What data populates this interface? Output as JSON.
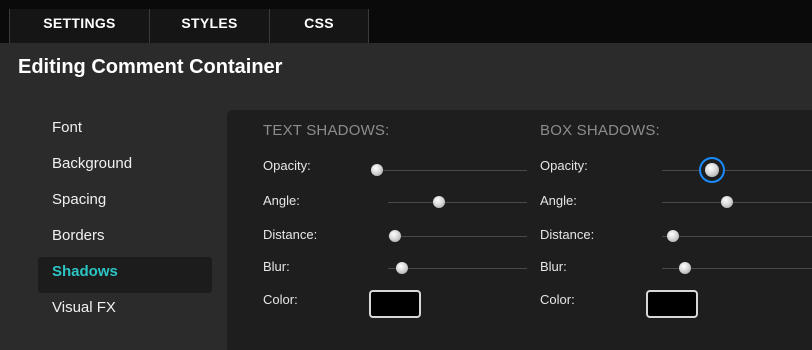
{
  "tabs": [
    {
      "label": "SETTINGS"
    },
    {
      "label": "STYLES"
    },
    {
      "label": "CSS"
    }
  ],
  "title": "Editing Comment Container",
  "sidebar": {
    "items": [
      {
        "label": "Font"
      },
      {
        "label": "Background"
      },
      {
        "label": "Spacing"
      },
      {
        "label": "Borders"
      },
      {
        "label": "Shadows",
        "active": true
      },
      {
        "label": "Visual FX"
      }
    ]
  },
  "text_shadows": {
    "heading": "TEXT SHADOWS:",
    "opacity": {
      "label": "Opacity:",
      "value_fraction": 0.0
    },
    "angle": {
      "label": "Angle:",
      "value_fraction": 0.37
    },
    "distance": {
      "label": "Distance:",
      "value_fraction": 0.05
    },
    "blur": {
      "label": "Blur:",
      "value_fraction": 0.1
    },
    "color": {
      "label": "Color:",
      "value": "#000000"
    }
  },
  "box_shadows": {
    "heading": "BOX SHADOWS:",
    "opacity": {
      "label": "Opacity:",
      "value_fraction": 0.33
    },
    "angle": {
      "label": "Angle:",
      "value_fraction": 0.43
    },
    "distance": {
      "label": "Distance:",
      "value_fraction": 0.07
    },
    "blur": {
      "label": "Blur:",
      "value_fraction": 0.15
    },
    "color": {
      "label": "Color:",
      "value": "#000000"
    }
  },
  "colors": {
    "active_accent": "#2dc4c4",
    "focus_ring": "#1a8bff"
  }
}
